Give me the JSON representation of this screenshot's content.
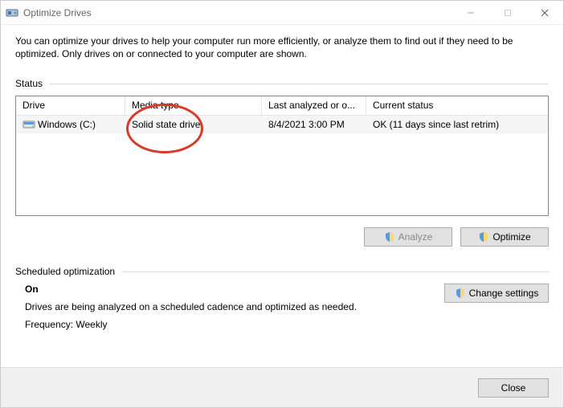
{
  "titlebar": {
    "title": "Optimize Drives"
  },
  "intro": "You can optimize your drives to help your computer run more efficiently, or analyze them to find out if they need to be optimized. Only drives on or connected to your computer are shown.",
  "status_label": "Status",
  "columns": {
    "drive": "Drive",
    "media": "Media type",
    "last": "Last analyzed or o...",
    "status": "Current status"
  },
  "rows": [
    {
      "drive": "Windows (C:)",
      "media": "Solid state drive",
      "last": "8/4/2021 3:00 PM",
      "status": "OK (11 days since last retrim)"
    }
  ],
  "buttons": {
    "analyze": "Analyze",
    "optimize": "Optimize",
    "change_settings": "Change settings",
    "close": "Close"
  },
  "sched": {
    "label": "Scheduled optimization",
    "on": "On",
    "desc": "Drives are being analyzed on a scheduled cadence and optimized as needed.",
    "freq": "Frequency: Weekly"
  }
}
